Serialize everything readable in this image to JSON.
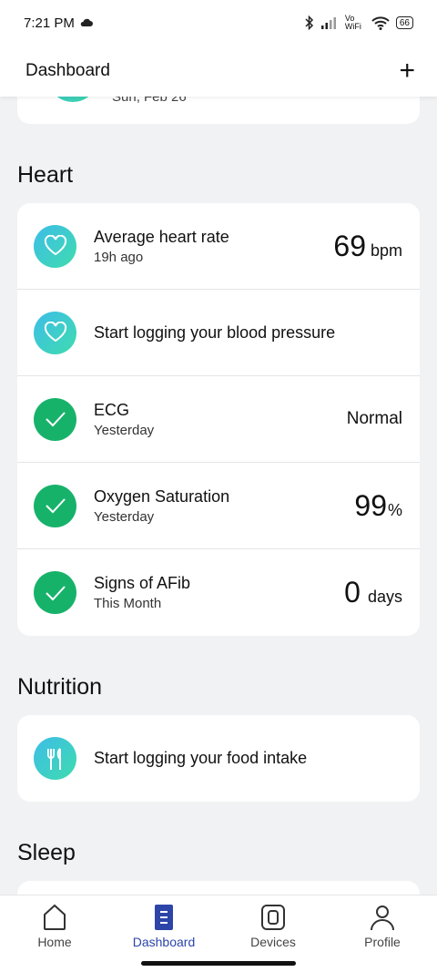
{
  "status": {
    "time": "7:21 PM",
    "network": "Vo WiFi",
    "battery": "66"
  },
  "header": {
    "title": "Dashboard",
    "add_label": "+"
  },
  "partial": {
    "text": "Sun, Feb 26"
  },
  "heart": {
    "title": "Heart",
    "rows": [
      {
        "title": "Average heart rate",
        "sub": "19h ago",
        "value": "69",
        "unit": "bpm"
      },
      {
        "title": "Start logging your blood pressure"
      },
      {
        "title": "ECG",
        "sub": "Yesterday",
        "value": "Normal"
      },
      {
        "title": "Oxygen Saturation",
        "sub": "Yesterday",
        "value": "99",
        "unit": "%"
      },
      {
        "title": "Signs of AFib",
        "sub": "This Month",
        "value": "0",
        "unit": "days"
      }
    ]
  },
  "nutrition": {
    "title": "Nutrition",
    "row": {
      "title": "Start logging your food intake"
    }
  },
  "sleep": {
    "title": "Sleep"
  },
  "nav": {
    "items": [
      {
        "label": "Home",
        "icon": "home-icon"
      },
      {
        "label": "Dashboard",
        "icon": "dashboard-icon"
      },
      {
        "label": "Devices",
        "icon": "watch-icon"
      },
      {
        "label": "Profile",
        "icon": "profile-icon"
      }
    ],
    "active": "Dashboard"
  },
  "colors": {
    "accent": "#2d45a8",
    "check_green": "#17b26a",
    "gradient_start": "#3dbde8",
    "gradient_end": "#3edcae"
  }
}
